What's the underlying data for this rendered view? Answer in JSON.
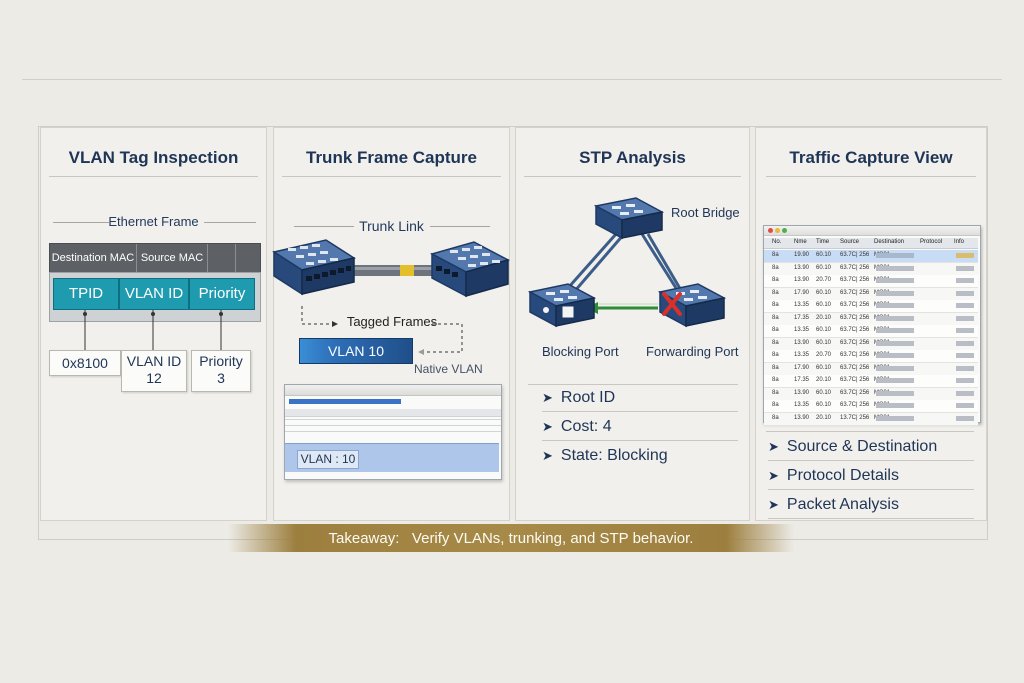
{
  "takeaway": {
    "prefix": "Takeaway:",
    "text": "Verify VLANs, trunking, and STP behavior."
  },
  "panels": {
    "vlan": {
      "title": "VLAN Tag Inspection",
      "ethernet_frame": "Ethernet Frame",
      "dest_mac": "Destination MAC",
      "source_mac": "Source MAC",
      "fields": [
        "TPID",
        "VLAN ID",
        "Priority"
      ],
      "values": {
        "tpid": "0x8100",
        "vlan_label": "VLAN ID",
        "vlan_value": "12",
        "priority_label": "Priority",
        "priority_value": "3"
      }
    },
    "trunk": {
      "title": "Trunk Frame Capture",
      "trunk_link": "Trunk Link",
      "tagged_frames": "Tagged Frames",
      "vlan_tag": "VLAN 10",
      "native_vlan": "Native VLAN",
      "capture_highlight": "VLAN : 10"
    },
    "stp": {
      "title": "STP Analysis",
      "root_bridge": "Root Bridge",
      "blocking_port": "Blocking Port",
      "forwarding_port": "Forwarding Port",
      "details": [
        "Root ID",
        "Cost: 4",
        "State: Blocking"
      ]
    },
    "traffic": {
      "title": "Traffic Capture View",
      "columns": [
        "No.",
        "Nme",
        "Time",
        "Source",
        "Destination",
        "Protocol",
        "Info"
      ],
      "rows": [
        [
          "8a",
          "19.90",
          "60.10",
          "63.7C| 256",
          "MC01"
        ],
        [
          "8a",
          "13.90",
          "60.10",
          "63.7C| 256",
          "MC01"
        ],
        [
          "8a",
          "13.90",
          "20.70",
          "63.7C| 256",
          "MC01"
        ],
        [
          "8a",
          "17.90",
          "60.10",
          "63.7C| 256",
          "MC01"
        ],
        [
          "8a",
          "13.35",
          "60.10",
          "63.7C| 256",
          "MC01"
        ],
        [
          "8a",
          "17.35",
          "20.10",
          "63.7C| 256",
          "MC01"
        ],
        [
          "8a",
          "13.35",
          "60.10",
          "63.7C| 256",
          "MC01"
        ],
        [
          "8a",
          "13.90",
          "60.10",
          "63.7C| 256",
          "MC01"
        ],
        [
          "8a",
          "13.35",
          "20.70",
          "63.7C| 256",
          "MC01"
        ],
        [
          "8a",
          "17.90",
          "60.10",
          "63.7C| 256",
          "MC01"
        ],
        [
          "8a",
          "17.35",
          "20.10",
          "63.7C| 256",
          "MC01"
        ],
        [
          "8a",
          "13.90",
          "60.10",
          "63.7C| 256",
          "MC01"
        ],
        [
          "8a",
          "13.35",
          "60.10",
          "63.7C| 256",
          "MC01"
        ],
        [
          "8a",
          "13.90",
          "20.10",
          "13.7C| 256",
          "MC01"
        ]
      ],
      "details": [
        "Source & Destination",
        "Protocol Details",
        "Packet Analysis"
      ]
    }
  },
  "colors": {
    "navy": "#1f3556",
    "teal": "#1f9bb0",
    "switch_blue": "#2f5588",
    "capture_blue": "#3a72c6",
    "takeaway_gold": "#a78a48",
    "block_red": "#d9302a",
    "forward_green": "#2f8a3a"
  }
}
